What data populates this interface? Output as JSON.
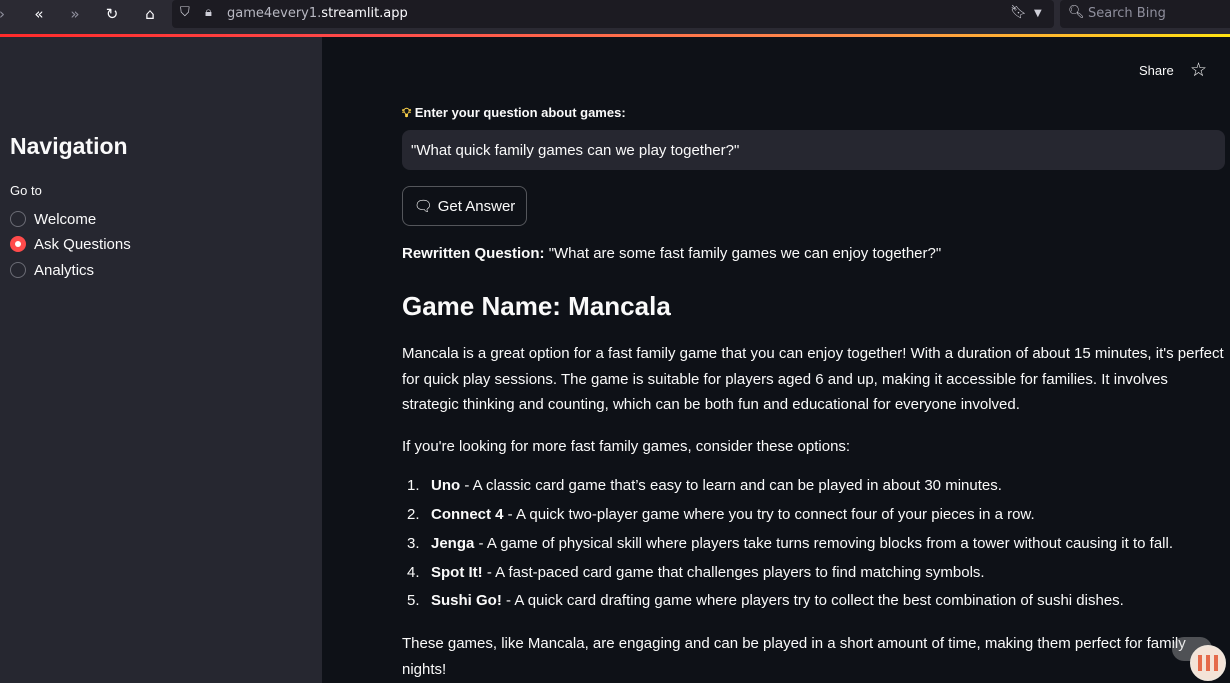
{
  "browser": {
    "url_host": "game4every1.",
    "url_domain": "streamlit.app",
    "search_placeholder": "Search Bing"
  },
  "sidebar": {
    "title": "Navigation",
    "goto_label": "Go to",
    "options": [
      {
        "label": "Welcome",
        "selected": false
      },
      {
        "label": "Ask Questions",
        "selected": true
      },
      {
        "label": "Analytics",
        "selected": false
      }
    ]
  },
  "header": {
    "share_label": "Share"
  },
  "main": {
    "question_label": "Enter your question about games:",
    "question_value": "\"What quick family games can we play together?\"",
    "answer_button": "Get Answer",
    "rewritten_label": "Rewritten Question:",
    "rewritten_value": "\"What are some fast family games we can enjoy together?\"",
    "game_heading": "Game Name: Mancala",
    "paragraph1": "Mancala is a great option for a fast family game that you can enjoy together! With a duration of about 15 minutes, it's perfect for quick play sessions. The game is suitable for players aged 6 and up, making it accessible for families. It involves strategic thinking and counting, which can be both fun and educational for everyone involved.",
    "paragraph2": "If you're looking for more fast family games, consider these options:",
    "games": [
      {
        "num": "1.",
        "name": "Uno",
        "desc": " - A classic card game that’s easy to learn and can be played in about 30 minutes."
      },
      {
        "num": "2.",
        "name": "Connect 4",
        "desc": " - A quick two-player game where you try to connect four of your pieces in a row."
      },
      {
        "num": "3.",
        "name": "Jenga",
        "desc": " - A game of physical skill where players take turns removing blocks from a tower without causing it to fall."
      },
      {
        "num": "4.",
        "name": "Spot It!",
        "desc": " - A fast-paced card game that challenges players to find matching symbols."
      },
      {
        "num": "5.",
        "name": "Sushi Go!",
        "desc": " - A quick card drafting game where players try to collect the best combination of sushi dishes."
      }
    ],
    "paragraph3": "These games, like Mancala, are engaging and can be played in a short amount of time, making them perfect for family nights!"
  },
  "colors": {
    "accent": "#ff4b4b",
    "sidebar_bg": "#262730",
    "main_bg": "#0e1117",
    "text": "#fafafa"
  }
}
